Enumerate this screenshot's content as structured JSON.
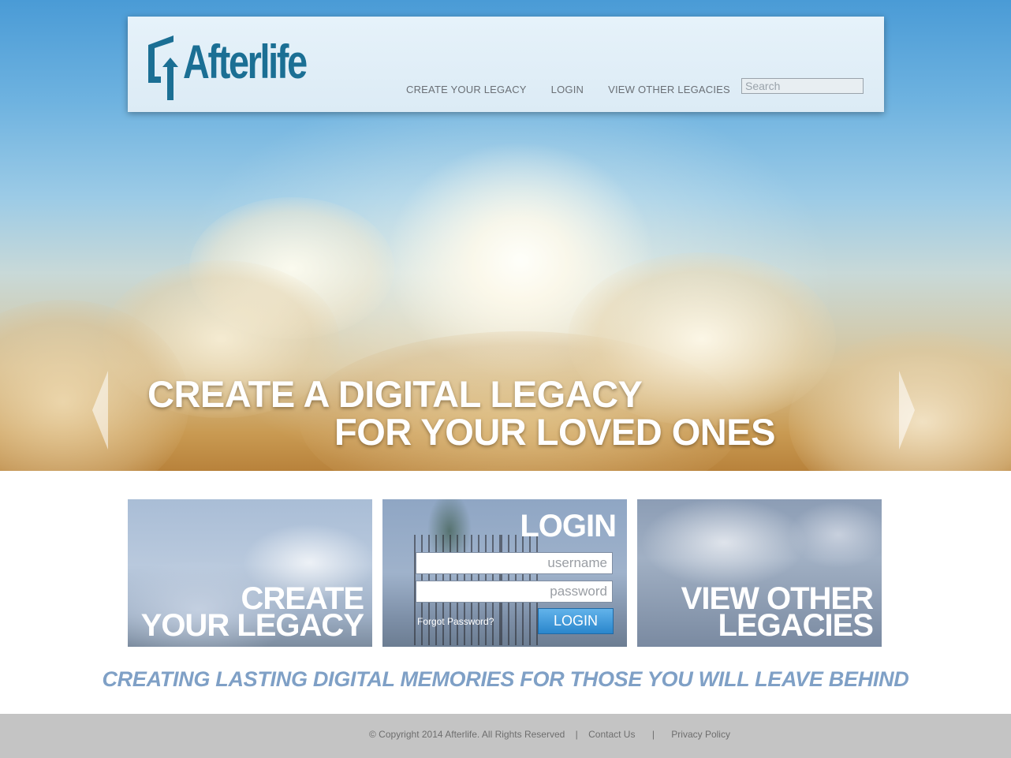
{
  "header": {
    "logo_text": "Afterlife",
    "nav": [
      {
        "label": "CREATE YOUR LEGACY"
      },
      {
        "label": "LOGIN"
      },
      {
        "label": "VIEW OTHER LEGACIES"
      }
    ],
    "search_placeholder": "Search"
  },
  "hero": {
    "line1": "CREATE A DIGITAL LEGACY",
    "line2": "FOR YOUR LOVED ONES"
  },
  "tiles": {
    "create": {
      "line1": "CREATE",
      "line2": "YOUR LEGACY"
    },
    "login": {
      "title": "LOGIN",
      "username_placeholder": "username",
      "password_placeholder": "password",
      "forgot": "Forgot Password?",
      "button": "LOGIN"
    },
    "view": {
      "line1": "VIEW OTHER",
      "line2": "LEGACIES"
    }
  },
  "tagline": "CREATING LASTING DIGITAL MEMORIES FOR THOSE YOU WILL LEAVE BEHIND",
  "footer": {
    "copyright": "© Copyright 2014 Afterlife. All Rights Reserved",
    "separator": "|",
    "contact": "Contact Us",
    "privacy": "Privacy Policy"
  },
  "colors": {
    "accent_blue": "#1b6f94",
    "tagline": "#7fa0c6",
    "footer_bg": "#c4c4c4"
  }
}
